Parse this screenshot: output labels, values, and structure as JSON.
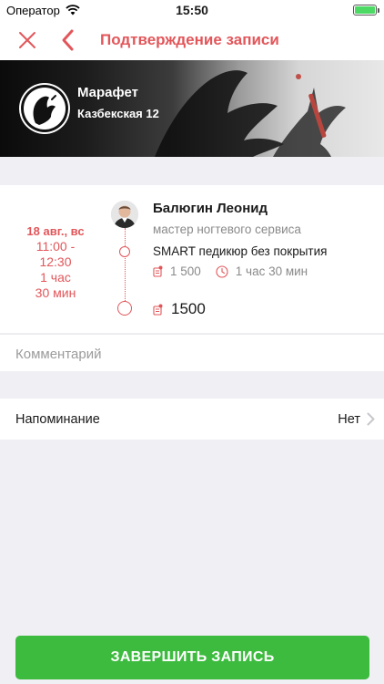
{
  "status_bar": {
    "carrier": "Оператор",
    "time": "15:50",
    "battery_level": 1.0
  },
  "nav": {
    "title": "Подтверждение записи",
    "close_icon": "close-icon",
    "back_icon": "chevron-left-icon"
  },
  "salon": {
    "name": "Марафет",
    "address": "Казбекская 12"
  },
  "appointment": {
    "date": "18 авг., вс",
    "time_range": [
      "11:00 -",
      "12:30"
    ],
    "duration_lines": [
      "1 час",
      "30 мин"
    ],
    "master": {
      "name": "Балюгин Леонид",
      "role": "мастер ногтевого сервиса"
    },
    "service": {
      "name": "SMART педикюр без покрытия",
      "price": "1 500",
      "duration": "1 час 30 мин"
    },
    "total": "1500"
  },
  "comment": {
    "placeholder": "Комментарий"
  },
  "reminder": {
    "label": "Напоминание",
    "value": "Нет"
  },
  "actions": {
    "finish_label": "ЗАВЕРШИТЬ ЗАПИСЬ"
  },
  "colors": {
    "accent": "#e2565a",
    "confirm": "#3dbb3f",
    "background": "#efeff4"
  }
}
